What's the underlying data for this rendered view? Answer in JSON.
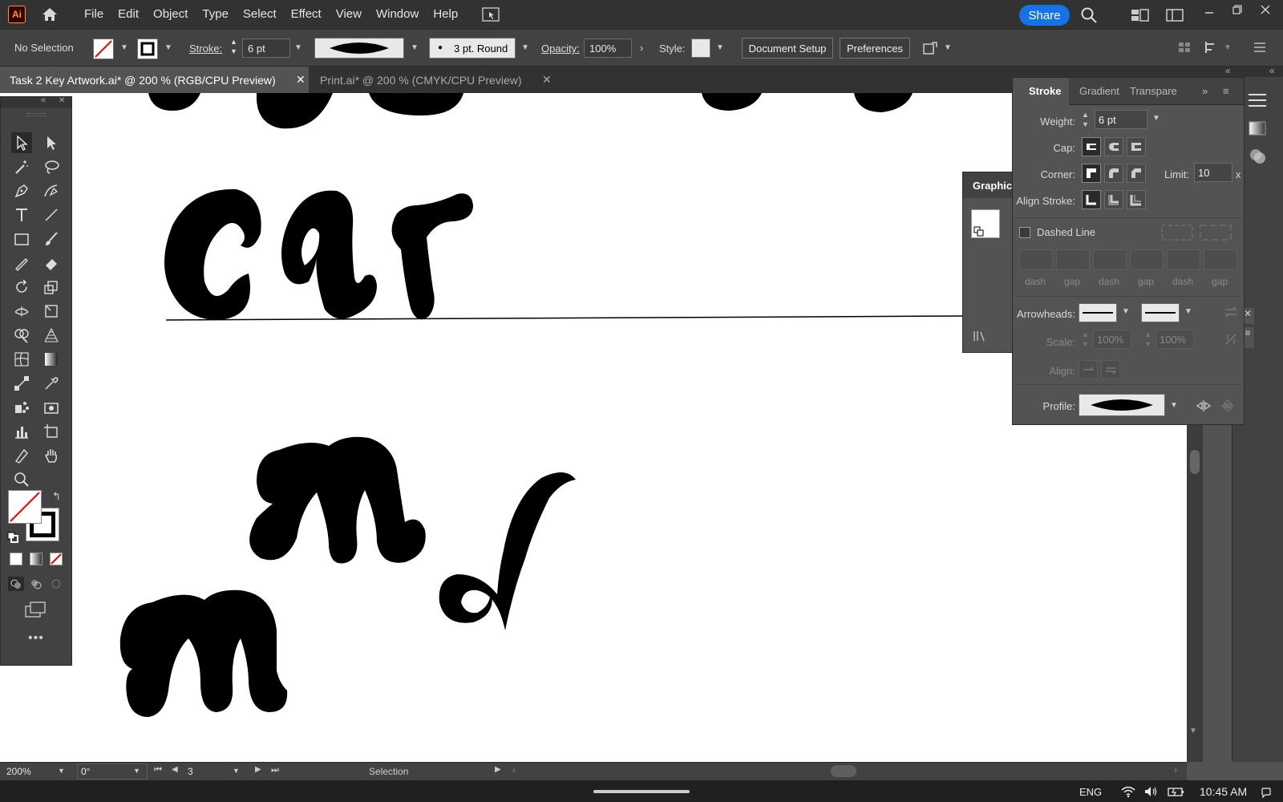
{
  "app": {
    "logo": "Ai"
  },
  "menu": [
    "File",
    "Edit",
    "Object",
    "Type",
    "Select",
    "Effect",
    "View",
    "Window",
    "Help"
  ],
  "share_label": "Share",
  "control": {
    "selection_label": "No Selection",
    "stroke_label": "Stroke:",
    "stroke_value": "6 pt",
    "brush_label": "3 pt. Round",
    "opacity_label": "Opacity:",
    "opacity_value": "100%",
    "style_label": "Style:",
    "document_setup": "Document Setup",
    "preferences": "Preferences"
  },
  "tabs": [
    {
      "title": "Task 2 Key Artwork.ai* @ 200 % (RGB/CPU Preview)",
      "active": true
    },
    {
      "title": "Print.ai* @ 200 % (CMYK/CPU Preview)",
      "active": false
    }
  ],
  "stroke_panel": {
    "tabs": [
      "Stroke",
      "Gradient",
      "Transpare"
    ],
    "weight_label": "Weight:",
    "weight_value": "6 pt",
    "cap_label": "Cap:",
    "corner_label": "Corner:",
    "limit_label": "Limit:",
    "limit_value": "10",
    "limit_unit": "x",
    "align_label": "Align Stroke:",
    "dashed_label": "Dashed Line",
    "dash_labels": [
      "dash",
      "gap",
      "dash",
      "gap",
      "dash",
      "gap"
    ],
    "arrowheads_label": "Arrowheads:",
    "scale_label": "Scale:",
    "scale_values": [
      "100%",
      "100%"
    ],
    "align_arrow_label": "Align:",
    "profile_label": "Profile:"
  },
  "graphic_styles": {
    "title": "Graphic"
  },
  "status": {
    "zoom": "200%",
    "rotation": "0°",
    "artboard": "3",
    "tool": "Selection"
  },
  "taskbar": {
    "lang": "ENG",
    "time": "10:45 AM"
  },
  "colors": {
    "accent": "#1473e6",
    "panel": "#535353",
    "dark": "#323232",
    "ai_orange": "#ff9a00"
  }
}
